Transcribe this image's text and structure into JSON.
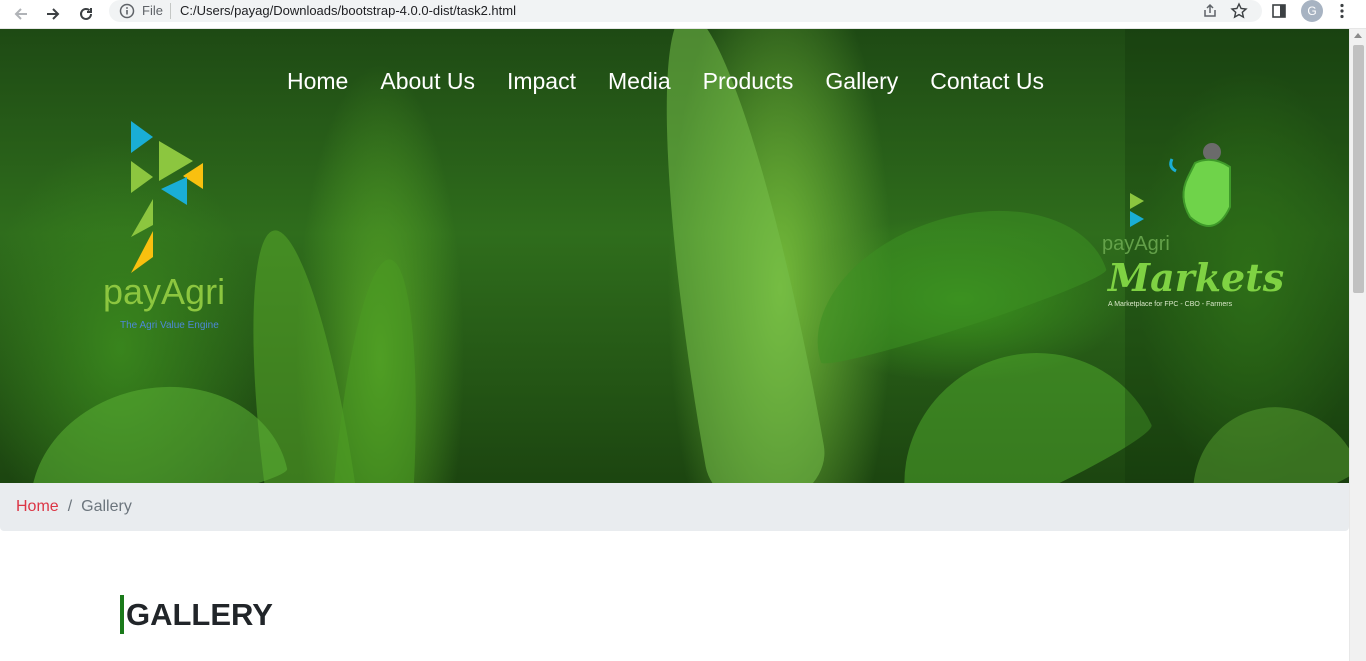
{
  "browser": {
    "file_label": "File",
    "url": "C:/Users/payag/Downloads/bootstrap-4.0.0-dist/task2.html",
    "profile_initial": "G"
  },
  "nav": {
    "items": [
      "Home",
      "About Us",
      "Impact",
      "Media",
      "Products",
      "Gallery",
      "Contact Us"
    ]
  },
  "brand_left": {
    "name": "payAgri",
    "tagline": "The Agri Value Engine"
  },
  "brand_right": {
    "name": "payAgri",
    "title": "Markets",
    "subtitle": "A Marketplace for FPC - CBO - Farmers"
  },
  "breadcrumb": {
    "home": "Home",
    "divider": "/",
    "current": "Gallery"
  },
  "page": {
    "heading": "GALLERY"
  },
  "colors": {
    "breadcrumb_link": "#dc3545",
    "heading_accent": "#1a7a1a",
    "logo_green": "#8cc63f",
    "logo_blue": "#1aaed6",
    "logo_yellow": "#f9c00f"
  }
}
